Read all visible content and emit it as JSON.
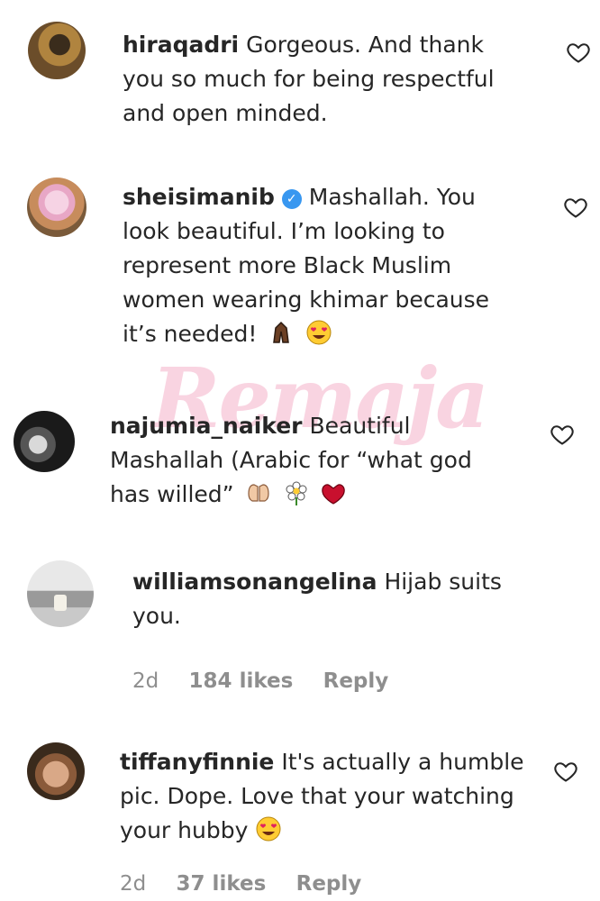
{
  "watermark": "Remaja",
  "comments": [
    {
      "username": "hiraqadri",
      "line1": "Gorgeous. And thank",
      "line2": "you so much for being respectful",
      "line3": "and open minded."
    },
    {
      "username": "sheisimanib",
      "line1": "Mashallah. You",
      "line2": "look beautiful. I’m looking to",
      "line3": "represent more Black Muslim",
      "line4": "women wearing khimar because",
      "line5": "it’s needed!",
      "emojis": [
        "praying-hands-icon",
        "heart-eyes-icon"
      ]
    },
    {
      "username": "najumia_naiker",
      "line1": "Beautiful",
      "line2": "Mashallah (Arabic for “what god",
      "line3": "has willed”",
      "emojis": [
        "open-hands-icon",
        "flower-icon",
        "heart-icon"
      ]
    },
    {
      "username": "williamsonangelina",
      "line1": "Hijab suits",
      "line2": "you.",
      "time": "2d",
      "likes": "184 likes",
      "reply": "Reply"
    },
    {
      "username": "tiffanyfinnie",
      "line1": "It's actually a humble",
      "line2": "pic. Dope. Love that your watching",
      "line3": "your hubby",
      "time": "2d",
      "likes": "37 likes",
      "reply": "Reply",
      "emojis": [
        "heart-eyes-icon"
      ]
    }
  ]
}
